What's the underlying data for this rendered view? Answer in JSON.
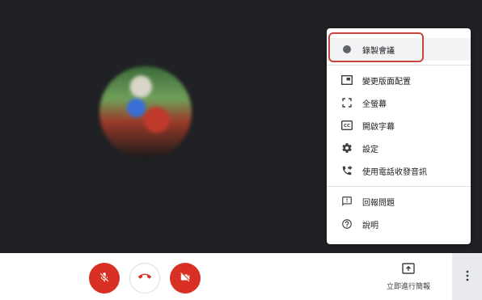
{
  "stage": {
    "participant_avatar": "participant-photo"
  },
  "controls": {
    "mic_button_icon": "mic-off-icon",
    "hangup_button_icon": "hangup-icon",
    "camera_button_icon": "camera-off-icon",
    "present_label": "立即進行簡報",
    "more_icon": "more-vertical-icon",
    "accent_red": "#d93025"
  },
  "menu": {
    "items": [
      {
        "label": "錄製會議",
        "icon": "record-dot-icon"
      },
      {
        "label": "變更版面配置",
        "icon": "layout-icon"
      },
      {
        "label": "全螢幕",
        "icon": "fullscreen-icon"
      },
      {
        "label": "開啟字幕",
        "icon": "captions-icon"
      },
      {
        "label": "設定",
        "icon": "gear-icon"
      },
      {
        "label": "使用電話收發音訊",
        "icon": "phone-forward-icon"
      },
      {
        "label": "回報問題",
        "icon": "report-problem-icon"
      },
      {
        "label": "說明",
        "icon": "help-icon"
      }
    ],
    "highlight_color": "#c9453f"
  }
}
